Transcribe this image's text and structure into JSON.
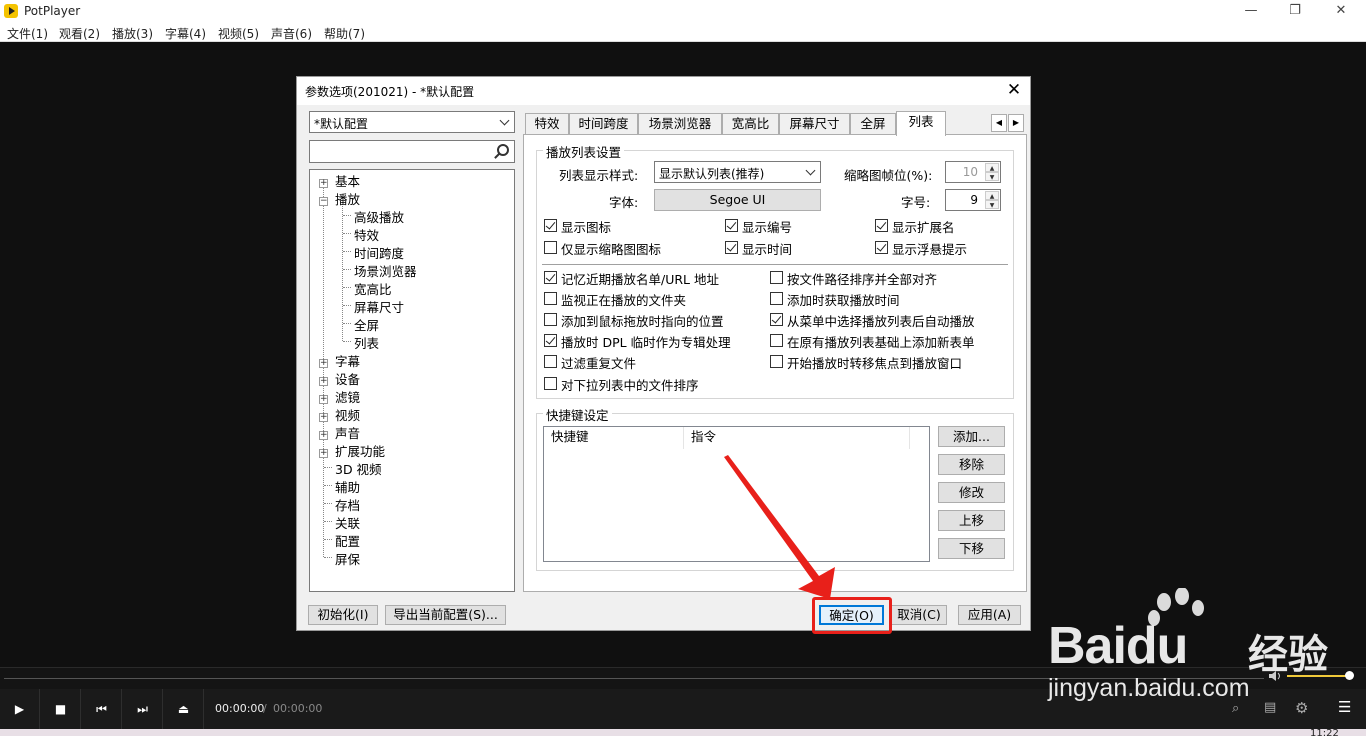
{
  "window": {
    "title": "PotPlayer",
    "minimize": "—",
    "maximize": "❐",
    "close": "✕"
  },
  "menu": [
    "文件(1)",
    "观看(2)",
    "播放(3)",
    "字幕(4)",
    "视频(5)",
    "声音(6)",
    "帮助(7)"
  ],
  "dialog": {
    "title": "参数选项(201021) - *默认配置",
    "close": "✕",
    "profile": "*默认配置",
    "search_placeholder": "",
    "tree": [
      "基本",
      "播放",
      "高级播放",
      "特效",
      "时间跨度",
      "场景浏览器",
      "宽高比",
      "屏幕尺寸",
      "全屏",
      "列表",
      "字幕",
      "设备",
      "滤镜",
      "视频",
      "声音",
      "扩展功能",
      "3D 视频",
      "辅助",
      "存档",
      "关联",
      "配置",
      "屏保"
    ],
    "tabs": [
      "特效",
      "时间跨度",
      "场景浏览器",
      "宽高比",
      "屏幕尺寸",
      "全屏",
      "列表"
    ],
    "active_tab": "列表",
    "playlist": {
      "group_label": "播放列表设置",
      "style_label": "列表显示样式:",
      "style_value": "显示默认列表(推荐)",
      "thumb_label": "缩略图帧位(%):",
      "thumb_value": "10",
      "font_label": "字体:",
      "font_value": "Segoe UI",
      "size_label": "字号:",
      "size_value": "9",
      "options": [
        {
          "label": "显示图标",
          "checked": true
        },
        {
          "label": "显示编号",
          "checked": true
        },
        {
          "label": "显示扩展名",
          "checked": true
        },
        {
          "label": "仅显示缩略图图标",
          "checked": false
        },
        {
          "label": "显示时间",
          "checked": true
        },
        {
          "label": "显示浮悬提示",
          "checked": true
        },
        {
          "label": "记忆近期播放名单/URL 地址",
          "checked": true
        },
        {
          "label": "按文件路径排序并全部对齐",
          "checked": false
        },
        {
          "label": "监视正在播放的文件夹",
          "checked": false
        },
        {
          "label": "添加时获取播放时间",
          "checked": false
        },
        {
          "label": "添加到鼠标拖放时指向的位置",
          "checked": false
        },
        {
          "label": "从菜单中选择播放列表后自动播放",
          "checked": true
        },
        {
          "label": "播放时 DPL 临时作为专辑处理",
          "checked": true
        },
        {
          "label": "在原有播放列表基础上添加新表单",
          "checked": false
        },
        {
          "label": "过滤重复文件",
          "checked": false
        },
        {
          "label": "开始播放时转移焦点到播放窗口",
          "checked": false
        },
        {
          "label": "对下拉列表中的文件排序",
          "checked": false
        }
      ]
    },
    "hotkeys": {
      "group_label": "快捷键设定",
      "col_key": "快捷键",
      "col_cmd": "指令",
      "buttons": [
        "添加...",
        "移除",
        "修改",
        "上移",
        "下移"
      ]
    },
    "footer": {
      "init": "初始化(I)",
      "export": "导出当前配置(S)...",
      "ok": "确定(O)",
      "cancel": "取消(C)",
      "apply": "应用(A)"
    }
  },
  "player": {
    "time_current": "00:00:00",
    "time_sep": "/",
    "time_total": "00:00:00",
    "volume": 0.95,
    "clock": "11:22"
  },
  "watermark": {
    "brand": "Baidu",
    "brand_cn": "经验",
    "url": "jingyan.baidu.com"
  },
  "colors": {
    "annotation": "#e8201a",
    "volume": "#f0c93a",
    "ok_border": "#0078d7"
  }
}
